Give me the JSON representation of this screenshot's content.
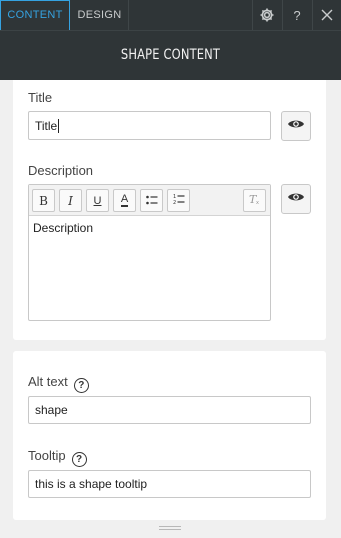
{
  "tabs": [
    {
      "label": "CONTENT",
      "active": true
    },
    {
      "label": "DESIGN",
      "active": false
    }
  ],
  "top_icons": [
    "gear-icon",
    "help-icon",
    "close-icon"
  ],
  "top_help_label": "?",
  "header": {
    "title": "SHAPE CONTENT"
  },
  "title_field": {
    "label": "Title",
    "value": "Title"
  },
  "description_field": {
    "label": "Description",
    "toolbar": [
      "bold",
      "italic",
      "underline",
      "font-color",
      "bulleted-list",
      "numbered-list",
      "clear-formatting"
    ],
    "toolbar_glyphs": {
      "bold": "B",
      "italic": "I",
      "underline": "U",
      "font_color": "A"
    },
    "value": "Description"
  },
  "alt_text_field": {
    "label": "Alt text",
    "help": "?",
    "value": "shape"
  },
  "tooltip_field": {
    "label": "Tooltip",
    "help": "?",
    "value": "this is a shape tooltip"
  },
  "colors": {
    "accent": "#35a2e0",
    "topbar": "#2f3537",
    "panel_bg": "#f0f0f0"
  }
}
